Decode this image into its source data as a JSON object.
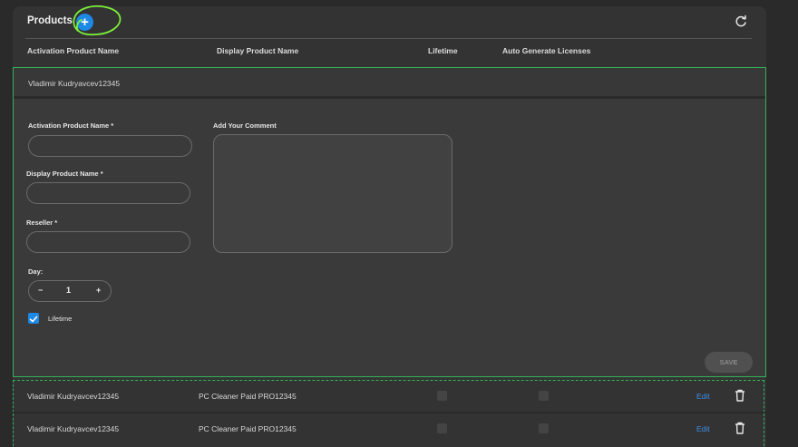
{
  "panel": {
    "title": "Products",
    "add_button_icon": "+",
    "refresh_icon": "refresh-icon"
  },
  "columns": {
    "activation": "Activation Product Name",
    "display": "Display Product Name",
    "lifetime": "Lifetime",
    "auto_generate": "Auto Generate Licenses"
  },
  "editor": {
    "header_value": "Vladimir Kudryavcev12345",
    "activation_label": "Activation Product Name *",
    "activation_value": "",
    "display_label": "Display Product Name *",
    "display_value": "",
    "reseller_label": "Reseller *",
    "reseller_value": "",
    "comment_label": "Add Your Comment",
    "comment_value": "",
    "day_label": "Day:",
    "day_minus": "−",
    "day_value": "1",
    "day_plus": "+",
    "lifetime_label": "Lifetime",
    "lifetime_checked": true,
    "save_label": "SAVE"
  },
  "rows": [
    {
      "activation": "Vladimir Kudryavcev12345",
      "display": "PC Cleaner Paid PRO12345",
      "lifetime": false,
      "auto_generate": false,
      "edit_label": "Edit"
    },
    {
      "activation": "Vladimir Kudryavcev12345",
      "display": "PC Cleaner Paid PRO12345",
      "lifetime": false,
      "auto_generate": false,
      "edit_label": "Edit"
    }
  ],
  "colors": {
    "accent": "#1e88e5",
    "highlight": "#7cf03a",
    "selection_border": "#35b35a",
    "panel_bg": "#333333"
  }
}
